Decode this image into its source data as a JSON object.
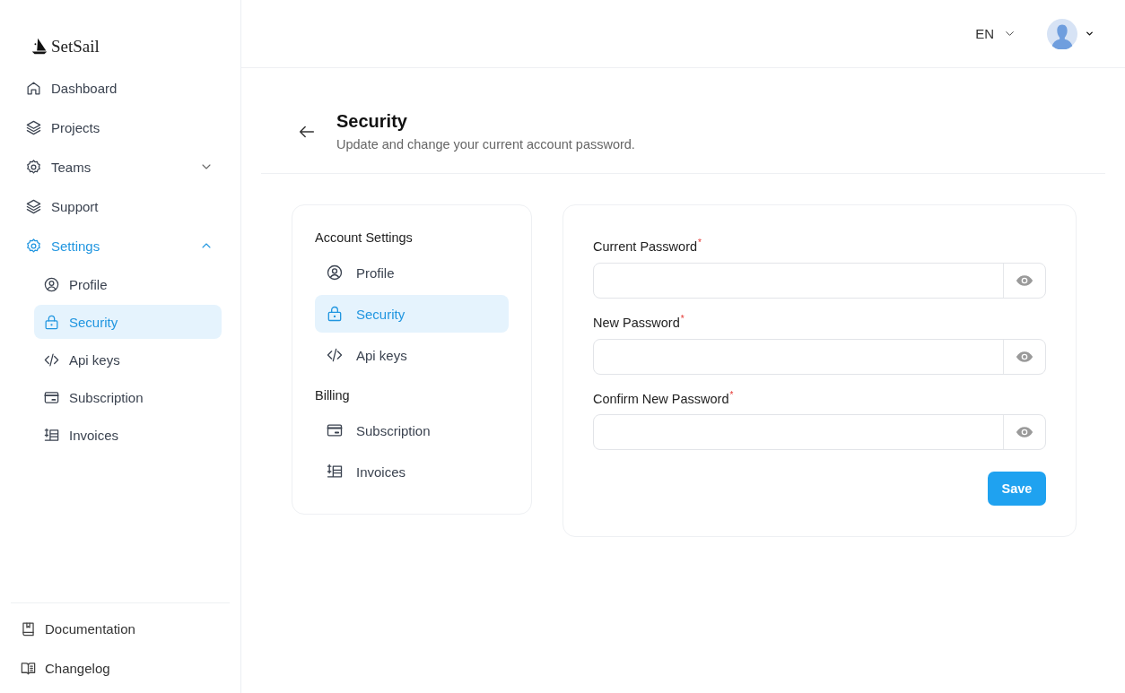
{
  "brand": {
    "name": "SetSail"
  },
  "sidebar": {
    "items": [
      {
        "label": "Dashboard",
        "kind": "link",
        "selected": false
      },
      {
        "label": "Projects",
        "kind": "link",
        "selected": false
      },
      {
        "label": "Teams",
        "kind": "group",
        "selected": false,
        "expanded": false
      },
      {
        "label": "Support",
        "kind": "link",
        "selected": false
      },
      {
        "label": "Settings",
        "kind": "group",
        "selected": true,
        "expanded": true,
        "children": [
          {
            "label": "Profile",
            "selected": false
          },
          {
            "label": "Security",
            "selected": true
          },
          {
            "label": "Api keys",
            "selected": false
          },
          {
            "label": "Subscription",
            "selected": false
          },
          {
            "label": "Invoices",
            "selected": false
          }
        ]
      }
    ],
    "footer": [
      {
        "label": "Documentation"
      },
      {
        "label": "Changelog"
      }
    ]
  },
  "header": {
    "language": "EN"
  },
  "page": {
    "title": "Security",
    "subtitle": "Update and change your current account password."
  },
  "settings_menu": {
    "sections": [
      {
        "title": "Account Settings",
        "items": [
          {
            "label": "Profile",
            "selected": false
          },
          {
            "label": "Security",
            "selected": true
          },
          {
            "label": "Api keys",
            "selected": false
          }
        ]
      },
      {
        "title": "Billing",
        "items": [
          {
            "label": "Subscription",
            "selected": false
          },
          {
            "label": "Invoices",
            "selected": false
          }
        ]
      }
    ]
  },
  "form": {
    "fields": [
      {
        "label": "Current Password",
        "required_mark": "*"
      },
      {
        "label": "New Password",
        "required_mark": "*"
      },
      {
        "label": "Confirm New Password",
        "required_mark": "*"
      }
    ],
    "button": "Save"
  }
}
